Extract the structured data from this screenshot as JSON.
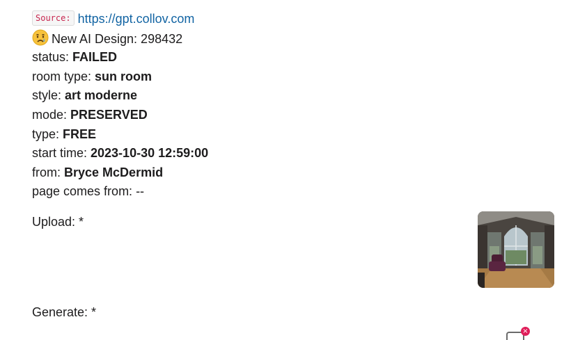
{
  "source": {
    "tag": "Source:",
    "url": "https://gpt.collov.com"
  },
  "header": {
    "emoji_icon": "crying-face-icon",
    "title": "New AI Design: 298432"
  },
  "fields": [
    {
      "label": "status: ",
      "value": "FAILED"
    },
    {
      "label": "room type: ",
      "value": "sun room"
    },
    {
      "label": "style: ",
      "value": "art moderne"
    },
    {
      "label": "mode: ",
      "value": "PRESERVED"
    },
    {
      "label": "type: ",
      "value": "FREE"
    },
    {
      "label": "start time: ",
      "value": "2023-10-30 12:59:00"
    },
    {
      "label": "from: ",
      "value": "Bryce McDermid"
    },
    {
      "label": "page comes from: ",
      "value": "--"
    }
  ],
  "upload": {
    "label": "Upload: *"
  },
  "generate": {
    "label": "Generate: *",
    "badge": "×"
  },
  "colors": {
    "link": "#1264a3",
    "source_tag_text": "#c7254e",
    "badge": "#e01e5a"
  }
}
